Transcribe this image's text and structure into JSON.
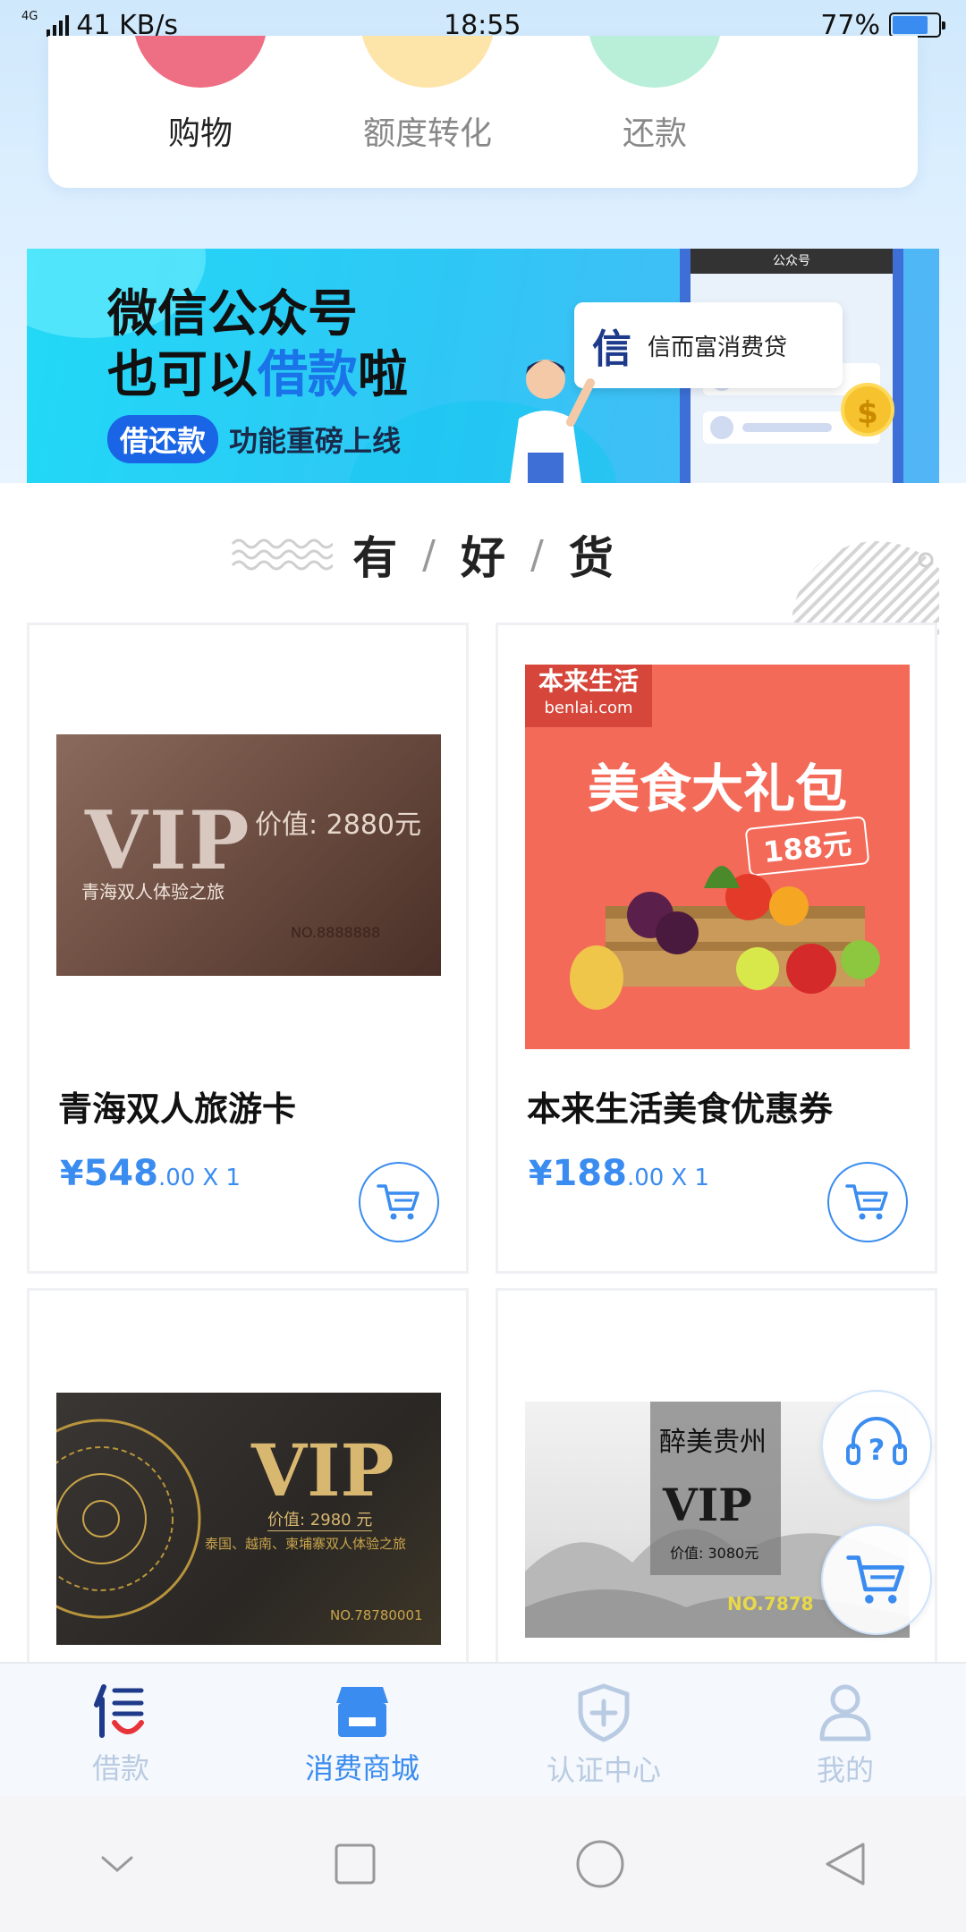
{
  "status_bar": {
    "network_tag": "4G",
    "speed": "41 KB/s",
    "time": "18:55",
    "battery_percent_text": "77%",
    "battery_level": 0.77
  },
  "quick_actions": [
    {
      "label": "购物",
      "color": "#ee6f84"
    },
    {
      "label": "额度转化",
      "color": "#fde4a8"
    },
    {
      "label": "还款",
      "color": "#b9efd8"
    }
  ],
  "banner": {
    "line1": "微信公众号",
    "line2_prefix": "也可以",
    "line2_highlight": "借款",
    "line2_suffix": "啦",
    "pill": "借还款",
    "sub": "功能重磅上线",
    "phone_top": "公众号",
    "chat_logo": "信",
    "chat_name": "信而富消费贷",
    "coin": "$"
  },
  "section": {
    "title_1": "有",
    "title_2": "好",
    "title_3": "货",
    "slash": "/"
  },
  "products": [
    {
      "title": "青海双人旅游卡",
      "yen": "¥",
      "price_int": "548",
      "price_dec": ".00",
      "qty": "X 1",
      "img": {
        "big": "VIP",
        "value": "价值: 2880元",
        "line": "青海双人体验之旅",
        "no": "NO.8888888"
      }
    },
    {
      "title": "本来生活美食优惠券",
      "yen": "¥",
      "price_int": "188",
      "price_dec": ".00",
      "qty": "X 1",
      "img": {
        "brand": "本来生活",
        "brand_url": "benlai.com",
        "big": "美食大礼包",
        "tag": "188元"
      }
    },
    {
      "img": {
        "big": "VIP",
        "value": "价值: 2980 元",
        "line": "泰国、越南、柬埔寨双人体验之旅",
        "no": "NO.78780001"
      }
    },
    {
      "img": {
        "brand": "醉美贵州",
        "big": "VIP",
        "value": "价值: 3080元",
        "no": "NO.7878"
      }
    }
  ],
  "tabbar": [
    {
      "label": "借款",
      "icon": "xin-logo-icon",
      "active": false
    },
    {
      "label": "消费商城",
      "icon": "store-icon",
      "active": true
    },
    {
      "label": "认证中心",
      "icon": "shield-plus-icon",
      "active": false
    },
    {
      "label": "我的",
      "icon": "person-icon",
      "active": false
    }
  ],
  "colors": {
    "accent": "#3a8cf0",
    "inactive_tab": "#b9cbe3"
  }
}
